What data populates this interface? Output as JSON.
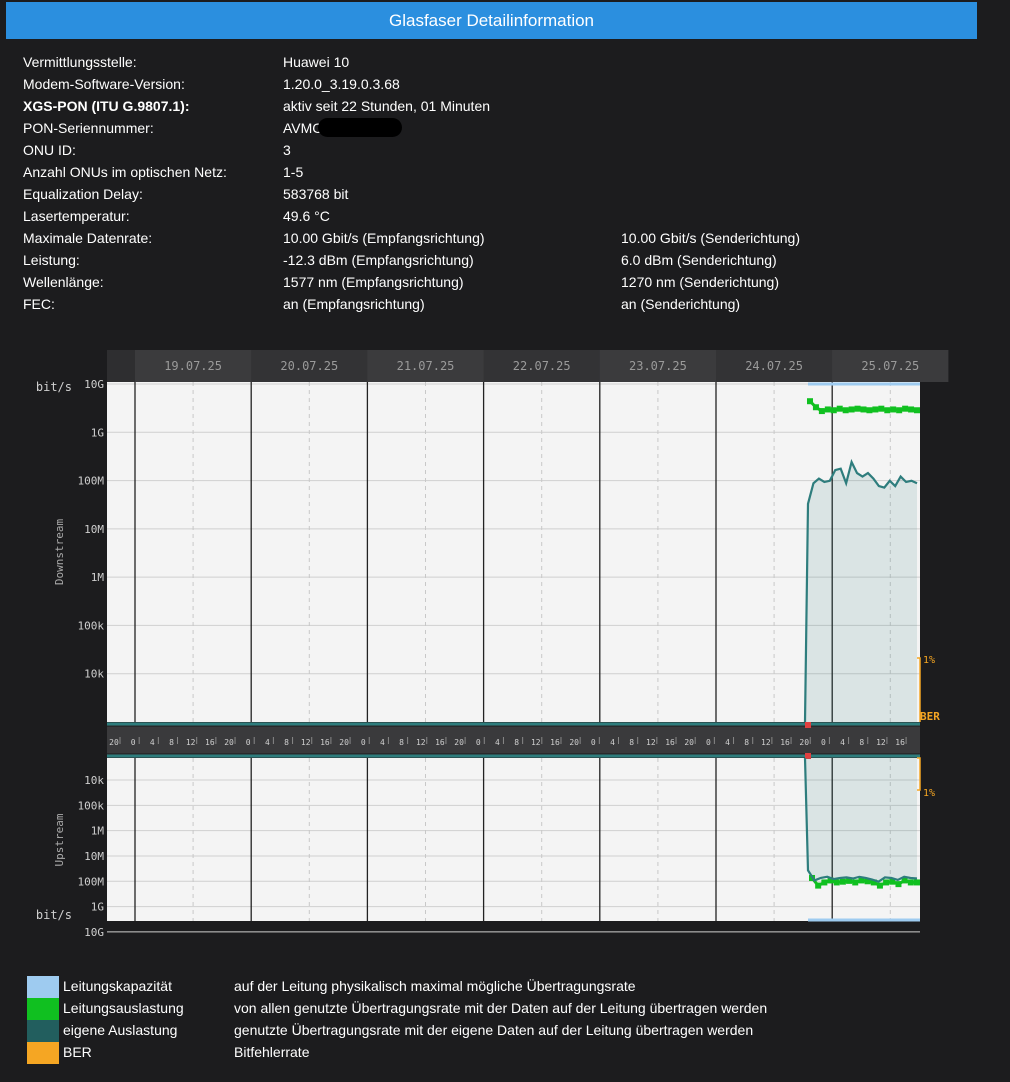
{
  "header": {
    "title": "Glasfaser Detailinformation"
  },
  "info": [
    {
      "label": "Vermittlungsstelle:",
      "value": "Huawei 10",
      "value2": ""
    },
    {
      "label": "Modem-Software-Version:",
      "value": "1.20.0_3.19.0.3.68",
      "value2": ""
    },
    {
      "label": "XGS-PON (ITU G.9807.1):",
      "value": "aktiv seit 22 Stunden, 01 Minuten",
      "value2": "",
      "bold": true
    },
    {
      "label": "PON-Seriennummer:",
      "value": "AVMC",
      "value2": "",
      "redacted": true
    },
    {
      "label": "ONU ID:",
      "value": "3",
      "value2": ""
    },
    {
      "label": "Anzahl ONUs im optischen Netz:",
      "value": "1-5",
      "value2": ""
    },
    {
      "label": "Equalization Delay:",
      "value": "583768 bit",
      "value2": ""
    },
    {
      "label": "Lasertemperatur:",
      "value": "49.6 °C",
      "value2": ""
    },
    {
      "label": "Maximale Datenrate:",
      "value": "10.00 Gbit/s (Empfangsrichtung)",
      "value2": "10.00 Gbit/s (Senderichtung)"
    },
    {
      "label": "Leistung:",
      "value": "-12.3 dBm (Empfangsrichtung)",
      "value2": "6.0 dBm (Senderichtung)"
    },
    {
      "label": "Wellenlänge:",
      "value": "1577 nm (Empfangsrichtung)",
      "value2": "1270 nm (Senderichtung)"
    },
    {
      "label": "FEC:",
      "value": "an (Empfangsrichtung)",
      "value2": "an (Senderichtung)"
    }
  ],
  "chart_data": {
    "type": "line",
    "dates": [
      "19.07.25",
      "20.07.25",
      "21.07.25",
      "22.07.25",
      "23.07.25",
      "24.07.25",
      "25.07.25"
    ],
    "hour_ticks": [
      "20",
      "0",
      "4",
      "8",
      "12",
      "16",
      "20",
      "0",
      "4",
      "8",
      "12",
      "16",
      "20",
      "0",
      "4",
      "8",
      "12",
      "16",
      "20",
      "0",
      "4",
      "8",
      "12",
      "16",
      "20",
      "0",
      "4",
      "8",
      "12",
      "16",
      "20",
      "0",
      "4",
      "8",
      "12",
      "16",
      "20",
      "0",
      "4",
      "8",
      "12",
      "16"
    ],
    "downstream": {
      "axis_title": "Downstream",
      "unit": "bit/s",
      "y_ticks": [
        "10G",
        "1G",
        "100M",
        "10M",
        "1M",
        "100k",
        "10k"
      ],
      "capacity_bps": 10000000000,
      "line_utilization_bps": [
        4000000000.0,
        3000000000.0,
        2500000000.0,
        2700000000.0,
        2600000000.0,
        2800000000.0,
        2600000000.0,
        2700000000.0,
        2800000000.0,
        2700000000.0,
        2600000000.0,
        2700000000.0,
        2800000000.0,
        2600000000.0,
        2700000000.0,
        2600000000.0,
        2800000000.0,
        2700000000.0,
        2600000000.0
      ],
      "own_utilization_bps": [
        30000000.0,
        80000000.0,
        100000000.0,
        85000000.0,
        90000000.0,
        150000000.0,
        160000000.0,
        80000000.0,
        220000000.0,
        130000000.0,
        110000000.0,
        130000000.0,
        100000000.0,
        70000000.0,
        65000000.0,
        90000000.0,
        70000000.0,
        110000000.0,
        85000000.0,
        90000000.0,
        80000000.0
      ]
    },
    "upstream": {
      "axis_title": "Upstream",
      "unit": "bit/s",
      "y_ticks": [
        "10k",
        "100k",
        "1M",
        "10M",
        "100M",
        "1G",
        "10G"
      ],
      "capacity_bps": 10000000000,
      "line_utilization_bps": [
        200000000.0,
        400000000.0,
        300000000.0,
        250000000.0,
        300000000.0,
        280000000.0,
        260000000.0,
        300000000.0,
        250000000.0,
        270000000.0,
        300000000.0,
        400000000.0,
        300000000.0,
        280000000.0,
        350000000.0,
        250000000.0,
        300000000.0,
        300000000.0
      ],
      "own_utilization_bps": [
        100000000.0,
        250000000.0,
        200000000.0,
        180000000.0,
        220000000.0,
        200000000.0,
        190000000.0,
        210000000.0,
        180000000.0,
        200000000.0,
        230000000.0,
        280000000.0,
        190000000.0,
        200000000.0,
        240000000.0,
        180000000.0,
        200000000.0,
        210000000.0
      ]
    },
    "ber": {
      "label": "BER",
      "scale_label": "1%"
    },
    "colors": {
      "capacity": "#9ecbf0",
      "line_utilization": "#10c020",
      "own_utilization": "#2e7d7d",
      "ber": "#f5a623"
    }
  },
  "legend": [
    {
      "color": "#9ecbf0",
      "name": "Leitungskapazität",
      "desc": "auf der Leitung physikalisch maximal mögliche Übertragungsrate"
    },
    {
      "color": "#10c020",
      "name": "Leitungsauslastung",
      "desc": "von allen genutzte Übertragungsrate mit der Daten auf der Leitung übertragen werden"
    },
    {
      "color": "#225e5e",
      "name": "eigene Auslastung",
      "desc": "genutzte Übertragungsrate mit der eigene Daten auf der Leitung übertragen werden"
    },
    {
      "color": "#f5a623",
      "name": "BER",
      "desc": "Bitfehlerrate"
    }
  ]
}
